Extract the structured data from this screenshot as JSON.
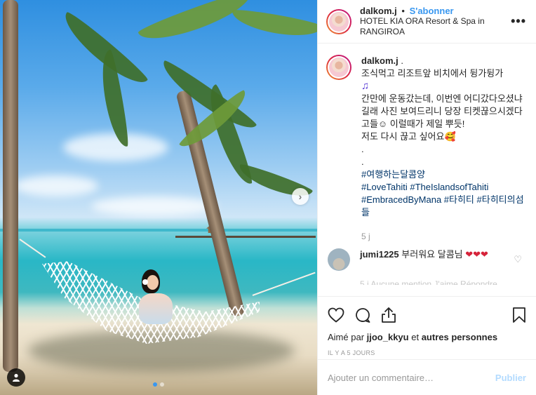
{
  "post": {
    "username": "dalkom.j",
    "separator": "•",
    "follow_label": "S'abonner",
    "location": "HOTEL KIA ORA Resort & Spa in RANGIROA",
    "more_icon": "more-options-icon"
  },
  "caption": {
    "username": "dalkom.j",
    "username_suffix": " .",
    "lines": [
      "조식먹고 리조트앞 비치에서 뒹가뒹가",
      "간만에 운동갔는데, 이번엔 어디갔다오셨냐길래 사진 보여드리니 당장 티켓끊으시겠다고들☺ 이럴때가 제일 뿌듯!",
      "저도 다시 끊고 싶어요🥰",
      ".",
      "."
    ],
    "music_note": "♫",
    "hashtags": [
      "#여행하는달콤양",
      "#LoveTahiti #TheIslandsofTahiti",
      "#EmbracedByMana #타히티 #타히티의섬들"
    ],
    "time_ago": "5 j"
  },
  "comment": {
    "username": "jumi1225",
    "text": "부러워요 달콤님",
    "hearts": "❤❤❤"
  },
  "faded_text": "5 j   Aucune mention J'aime   Répondre",
  "actions": {
    "liked_by_prefix": "Aimé par ",
    "liked_by_user": "jjoo_kkyu",
    "liked_by_suffix": " et ",
    "liked_by_others": "autres personnes",
    "posted_time": "IL Y A 5 JOURS"
  },
  "composer": {
    "placeholder": "Ajouter un commentaire…",
    "publish_label": "Publier"
  },
  "carousel": {
    "current_index": 1,
    "count": 2
  },
  "colors": {
    "accent": "#3897f0",
    "hashtag": "#003569",
    "heart": "#d6233a",
    "publish_disabled": "#b3dbff"
  }
}
